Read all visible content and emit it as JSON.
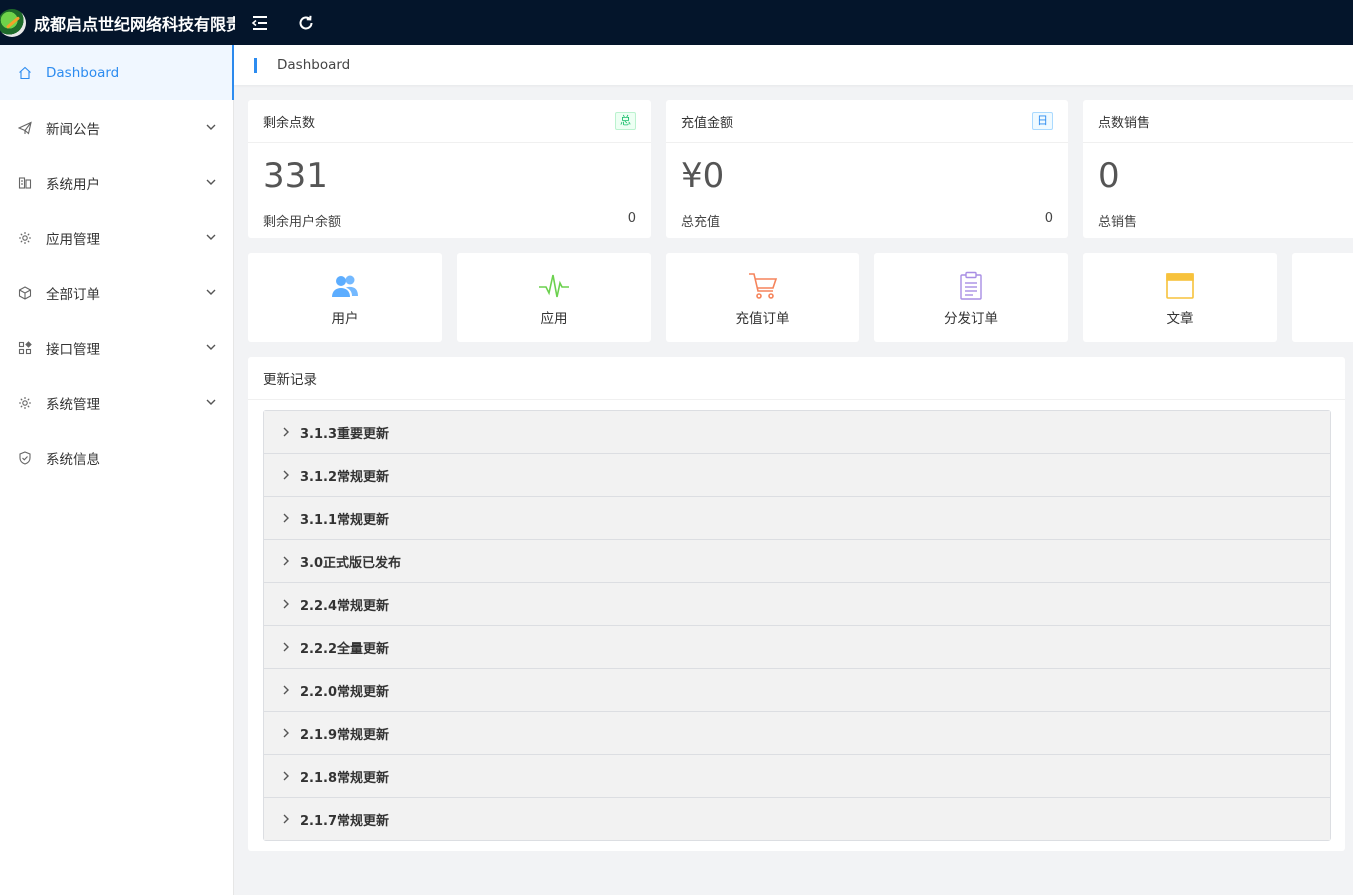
{
  "header": {
    "brand_title": "成都启点世纪网络科技有限责"
  },
  "sidebar": {
    "items": [
      {
        "label": "Dashboard",
        "icon": "home-icon",
        "active": true,
        "has_children": false
      },
      {
        "label": "新闻公告",
        "icon": "send-icon",
        "active": false,
        "has_children": true
      },
      {
        "label": "系统用户",
        "icon": "user-group-icon",
        "active": false,
        "has_children": true
      },
      {
        "label": "应用管理",
        "icon": "gear-icon",
        "active": false,
        "has_children": true
      },
      {
        "label": "全部订单",
        "icon": "box-icon",
        "active": false,
        "has_children": true
      },
      {
        "label": "接口管理",
        "icon": "apps-icon",
        "active": false,
        "has_children": true
      },
      {
        "label": "系统管理",
        "icon": "gear-icon",
        "active": false,
        "has_children": true
      },
      {
        "label": "系统信息",
        "icon": "shield-icon",
        "active": false,
        "has_children": false
      }
    ]
  },
  "breadcrumb": {
    "current": "Dashboard"
  },
  "stats": [
    {
      "title": "剩余点数",
      "badge": "总",
      "value": "331",
      "foot_label": "剩余用户余额",
      "foot_value": "0"
    },
    {
      "title": "充值金额",
      "badge": "日",
      "value": "¥0",
      "foot_label": "总充值",
      "foot_value": "0"
    },
    {
      "title": "点数销售",
      "badge": "",
      "value": "0",
      "foot_label": "总销售",
      "foot_value": ""
    }
  ],
  "shortcuts": [
    {
      "label": "用户",
      "icon": "users-icon",
      "color": "#5cadff"
    },
    {
      "label": "应用",
      "icon": "pulse-icon",
      "color": "#6cd14f"
    },
    {
      "label": "充值订单",
      "icon": "cart-icon",
      "color": "#f5845b"
    },
    {
      "label": "分发订单",
      "icon": "clipboard-icon",
      "color": "#a88ee4"
    },
    {
      "label": "文章",
      "icon": "browser-window-icon",
      "color": "#f7c23c"
    }
  ],
  "update_log": {
    "title": "更新记录",
    "entries": [
      "3.1.3重要更新",
      "3.1.2常规更新",
      "3.1.1常规更新",
      "3.0正式版已发布",
      "2.2.4常规更新",
      "2.2.2全量更新",
      "2.2.0常规更新",
      "2.1.9常规更新",
      "2.1.8常规更新",
      "2.1.7常规更新"
    ]
  },
  "colors": {
    "topbar": "#04152b",
    "accent": "#2d8cf0",
    "badge_green": "#19be6b"
  }
}
